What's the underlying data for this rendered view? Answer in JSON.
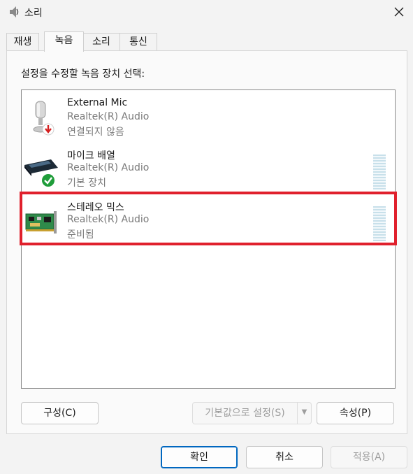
{
  "window": {
    "title": "소리",
    "close_glyph": "✕"
  },
  "tabs": [
    {
      "label": "재생",
      "active": false
    },
    {
      "label": "녹음",
      "active": true
    },
    {
      "label": "소리",
      "active": false
    },
    {
      "label": "통신",
      "active": false
    }
  ],
  "panel": {
    "instruction": "설정을 수정할 녹음 장치 선택:",
    "devices": [
      {
        "name": "External Mic",
        "driver": "Realtek(R) Audio",
        "status": "연결되지 않음",
        "icon": "microphone-unplugged-icon",
        "badge": "red-down-arrow"
      },
      {
        "name": "마이크 배열",
        "driver": "Realtek(R) Audio",
        "status": "기본 장치",
        "icon": "microphone-array-icon",
        "badge": "green-check"
      },
      {
        "name": "스테레오 믹스",
        "driver": "Realtek(R) Audio",
        "status": "준비됨",
        "icon": "sound-card-icon",
        "badge": "none",
        "highlighted": true
      }
    ],
    "configure_label": "구성(C)",
    "set_default_label": "기본값으로 설정(S)",
    "set_default_arrow": "▼",
    "properties_label": "속성(P)"
  },
  "footer": {
    "ok_label": "확인",
    "cancel_label": "취소",
    "apply_label": "적용(A)"
  },
  "colors": {
    "highlight": "#e0202c",
    "accent": "#0067c0",
    "level_meter": "#c8e0ea"
  }
}
